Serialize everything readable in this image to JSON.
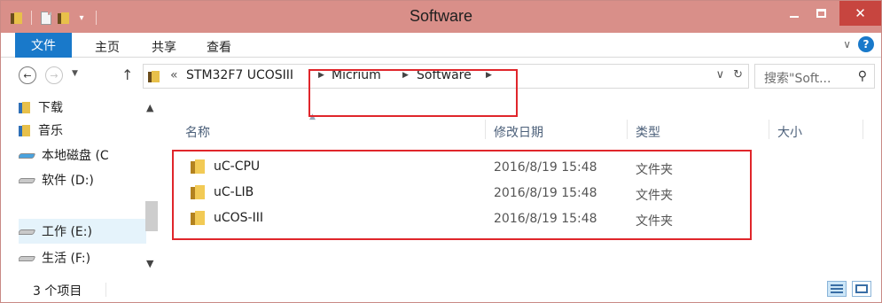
{
  "window": {
    "title": "Software",
    "close_glyph": "✕"
  },
  "ribbon": {
    "file_tab": "文件",
    "tabs": [
      "主页",
      "共享",
      "查看"
    ]
  },
  "address": {
    "prefix": "«",
    "crumbs": [
      "STM32F7 UCOSIII",
      "Micrium",
      "Software"
    ],
    "search_placeholder": "搜索\"Soft...",
    "refresh_glyph": "↻",
    "dropdown_glyph": "∨"
  },
  "nav_pane": {
    "items": [
      {
        "label": "下载",
        "icon": "downloads-folder-icon"
      },
      {
        "label": "音乐",
        "icon": "music-folder-icon"
      },
      {
        "label": "本地磁盘 (C",
        "icon": "os-drive-icon"
      },
      {
        "label": "软件 (D:)",
        "icon": "drive-icon"
      },
      {
        "label": "工作 (E:)",
        "icon": "drive-icon",
        "selected": true
      },
      {
        "label": "生活 (F:)",
        "icon": "drive-icon"
      }
    ]
  },
  "columns": {
    "name": "名称",
    "modified": "修改日期",
    "type": "类型",
    "size": "大小"
  },
  "files": [
    {
      "name": "uC-CPU",
      "modified": "2016/8/19 15:48",
      "type": "文件夹"
    },
    {
      "name": "uC-LIB",
      "modified": "2016/8/19 15:48",
      "type": "文件夹"
    },
    {
      "name": "uCOS-III",
      "modified": "2016/8/19 15:48",
      "type": "文件夹"
    }
  ],
  "status": {
    "item_count": "3 个项目"
  },
  "colors": {
    "titlebar": "#d98f89",
    "close_button": "#c7453f",
    "file_tab": "#1979ca",
    "highlight": "#e0262b"
  }
}
